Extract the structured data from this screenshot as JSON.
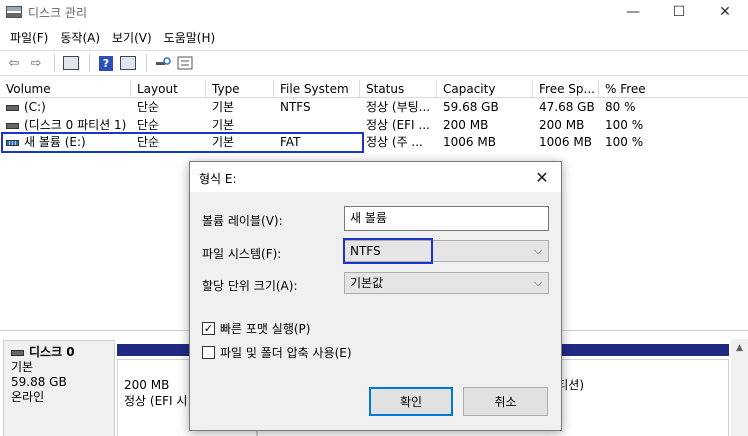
{
  "window": {
    "title": "디스크 관리",
    "minimize_glyph": "—",
    "maximize_glyph": "☐",
    "close_glyph": "✕"
  },
  "menu": {
    "items": [
      "파일(F)",
      "동작(A)",
      "보기(V)",
      "도움말(H)"
    ]
  },
  "toolbar": {
    "back_glyph": "⇦",
    "forward_glyph": "⇨",
    "help_glyph": "?",
    "icons": [
      "back-arrow-icon",
      "forward-arrow-icon",
      "properties-icon",
      "help-icon",
      "list-view-icon",
      "search-icon",
      "details-icon"
    ]
  },
  "volume_list": {
    "columns": [
      "Volume",
      "Layout",
      "Type",
      "File System",
      "Status",
      "Capacity",
      "Free Sp...",
      "% Free"
    ],
    "rows": [
      {
        "volume": "(C:)",
        "layout": "단순",
        "type": "기본",
        "fs": "NTFS",
        "status": "정상 (부팅...",
        "capacity": "59.68 GB",
        "free": "47.68 GB",
        "pct": "80 %"
      },
      {
        "volume": "(디스크 0 파티션 1)",
        "layout": "단순",
        "type": "기본",
        "fs": "",
        "status": "정상 (EFI ...",
        "capacity": "200 MB",
        "free": "200 MB",
        "pct": "100 %"
      },
      {
        "volume": "새 볼륨 (E:)",
        "layout": "단순",
        "type": "기본",
        "fs": "FAT",
        "status": "정상 (주 ...",
        "capacity": "1006 MB",
        "free": "1006 MB",
        "pct": "100 %"
      }
    ]
  },
  "disk": {
    "name": "디스크 0",
    "type": "기본",
    "size": "59.88 GB",
    "state": "온라인",
    "partitions": [
      {
        "size": "200 MB",
        "status": "정상 (EFI 시"
      },
      {
        "size": "",
        "status": "티션)"
      }
    ]
  },
  "dialog": {
    "title": "형식 E:",
    "close_glyph": "✕",
    "volume_label_label": "볼륨 레이블(V):",
    "volume_label_value": "새 볼륨",
    "filesystem_label": "파일 시스템(F):",
    "filesystem_value": "NTFS",
    "allocation_label": "할당 단위 크기(A):",
    "allocation_value": "기본값",
    "quick_format_label": "빠른 포맷 실행(P)",
    "quick_format_checked": true,
    "compression_label": "파일 및 폴더 압축 사용(E)",
    "compression_checked": false,
    "ok_label": "확인",
    "cancel_label": "취소",
    "chevron_glyph": "⌵"
  }
}
